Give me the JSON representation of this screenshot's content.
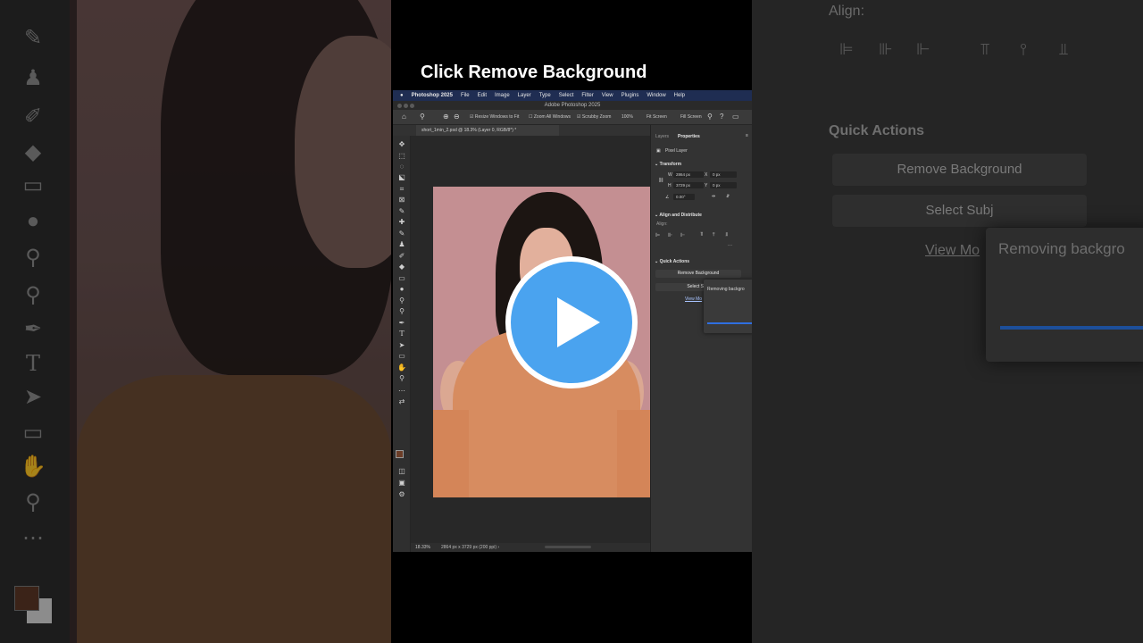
{
  "video": {
    "caption": "Click Remove Background",
    "play_label": "play"
  },
  "photoshop": {
    "menu": [
      "Photoshop 2025",
      "File",
      "Edit",
      "Image",
      "Layer",
      "Type",
      "Select",
      "Filter",
      "View",
      "Plugins",
      "Window",
      "Help"
    ],
    "window_title": "Adobe Photoshop 2025",
    "options": {
      "resize_windows": "Resize Windows to Fit",
      "zoom_all": "Zoom All Windows",
      "scrubby_zoom": "Scrubby Zoom",
      "zoom_value": "100%",
      "fit_screen": "Fit Screen",
      "fill_screen": "Fill Screen"
    },
    "document_tab": "short_1min_2.psd @ 18.3% (Layer 0, RGB/8*) *",
    "status": {
      "zoom": "18.33%",
      "doc_info": "2864 px x 3729 px (200 ppi)",
      "chevron": "›"
    },
    "panel": {
      "tabs": [
        "Layers",
        "Properties"
      ],
      "pixel_layer": "Pixel Layer",
      "transform_heading": "Transform",
      "w_label": "W",
      "w_value": "2864 px",
      "h_label": "H",
      "h_value": "3729 px",
      "x_label": "X",
      "x_value": "0 px",
      "y_label": "Y",
      "y_value": "0 px",
      "angle_value": "0.00°",
      "align_heading": "Align and Distribute",
      "align_label": "Align:",
      "more": "···",
      "quick_actions_heading": "Quick Actions",
      "remove_bg_button": "Remove Background",
      "select_subject_button": "Select Subj",
      "view_more_link": "View Mo"
    },
    "popup": {
      "message": "Removing backgro"
    }
  },
  "backdrop_right": {
    "align_label": "Align:",
    "quick_actions": "Quick Actions",
    "remove_bg": "Remove Background",
    "select_subj": "Select Subj",
    "view_more": "View Mo",
    "removing": "Removing backgro"
  }
}
